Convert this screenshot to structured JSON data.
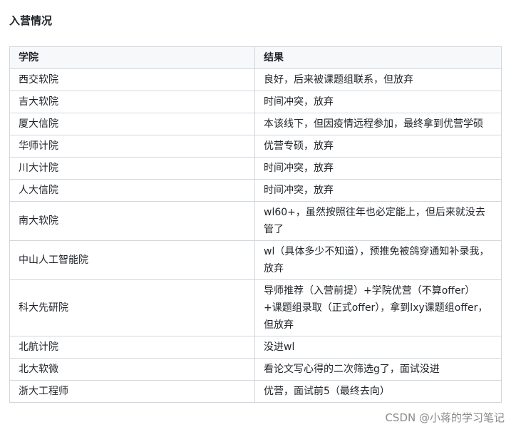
{
  "heading": "入营情况",
  "table": {
    "headers": [
      "学院",
      "结果"
    ],
    "rows": [
      {
        "school": "西交软院",
        "result": "良好，后来被课题组联系，但放弃"
      },
      {
        "school": "吉大软院",
        "result": "时间冲突，放弃"
      },
      {
        "school": "厦大信院",
        "result": "本该线下，但因疫情远程参加，最终拿到优营学硕"
      },
      {
        "school": "华师计院",
        "result": "优营专硕，放弃"
      },
      {
        "school": "川大计院",
        "result": "时间冲突，放弃"
      },
      {
        "school": "人大信院",
        "result": "时间冲突，放弃"
      },
      {
        "school": "南大软院",
        "result": "wl60+，虽然按照往年也必定能上，但后来就没去管了"
      },
      {
        "school": "中山人工智能院",
        "result": "wl（具体多少不知道），预推免被鸽穿通知补录我，放弃"
      },
      {
        "school": "科大先研院",
        "result": "导师推荐（入营前提）+学院优营（不算offer）+课题组录取（正式offer），拿到lxy课题组offer，但放弃"
      },
      {
        "school": "北航计院",
        "result": "没进wl"
      },
      {
        "school": "北大软微",
        "result": "看论文写心得的二次筛选g了，面试没进"
      },
      {
        "school": "浙大工程师",
        "result": "优营，面试前5（最终去向）"
      }
    ]
  },
  "watermark": "CSDN @小蒋的学习笔记"
}
